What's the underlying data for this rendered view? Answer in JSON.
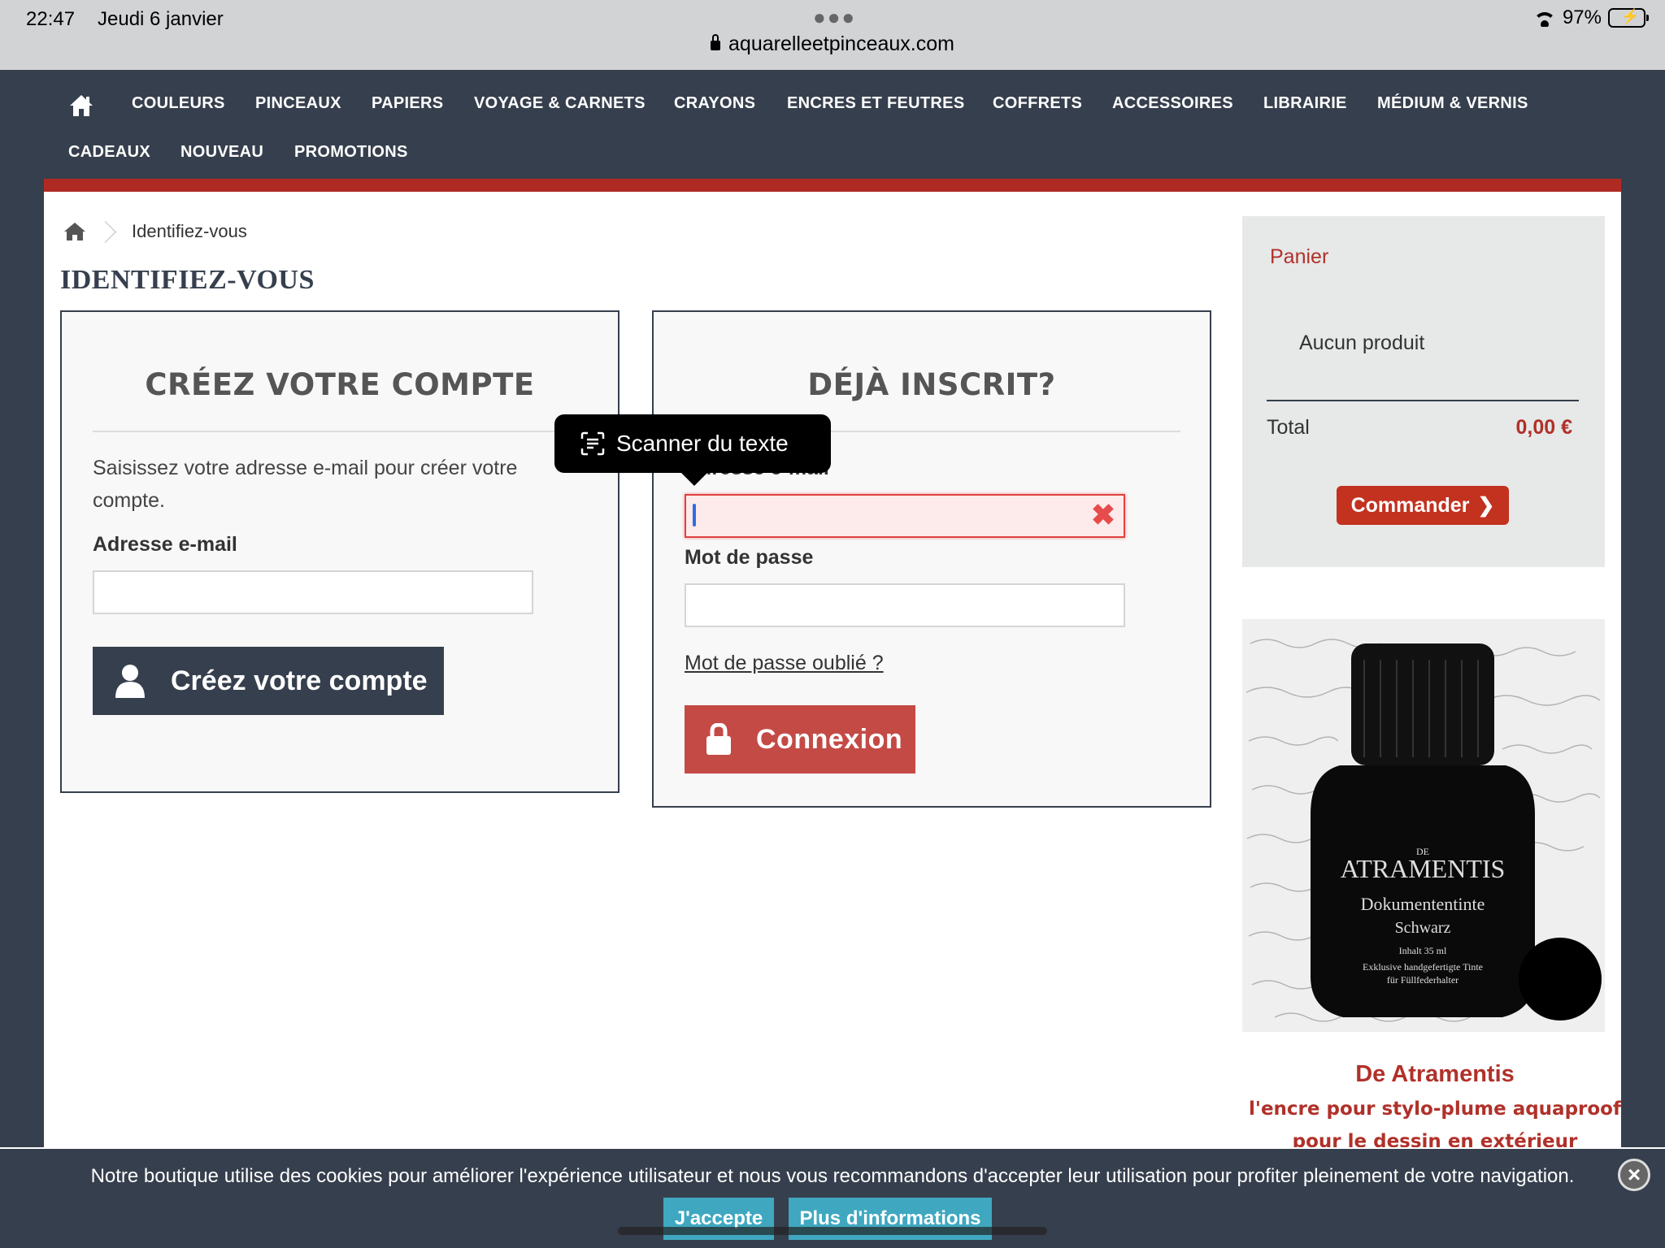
{
  "status_bar": {
    "time": "22:47",
    "date": "Jeudi 6 janvier",
    "battery": "97%",
    "url": "aquarelleetpinceaux.com"
  },
  "nav": {
    "row1": [
      "COULEURS",
      "PINCEAUX",
      "PAPIERS",
      "VOYAGE & CARNETS",
      "CRAYONS",
      "ENCRES ET FEUTRES",
      "COFFRETS",
      "ACCESSOIRES",
      "LIBRAIRIE",
      "MÉDIUM & VERNIS"
    ],
    "row2": [
      "CADEAUX",
      "NOUVEAU",
      "PROMOTIONS"
    ]
  },
  "breadcrumb": {
    "current": "Identifiez-vous"
  },
  "page_title": "IDENTIFIEZ-VOUS",
  "create_account": {
    "title": "CRÉEZ VOTRE COMPTE",
    "description": "Saisissez votre adresse e-mail pour créer votre compte.",
    "email_label": "Adresse e-mail",
    "email_value": "",
    "button": "Créez votre compte"
  },
  "login": {
    "title": "DÉJÀ INSCRIT?",
    "email_label": "Adresse e-mail",
    "email_value": "",
    "password_label": "Mot de passe",
    "password_value": "",
    "forgot": "Mot de passe oublié ?",
    "button": "Connexion"
  },
  "tooltip": {
    "label": "Scanner du texte"
  },
  "cart": {
    "title": "Panier",
    "empty": "Aucun produit",
    "total_label": "Total",
    "total_value": "0,00 €",
    "button": "Commander"
  },
  "ad": {
    "brand_top": "DE",
    "brand": "ATRAMENTIS",
    "product": "Dokumententinte",
    "color": "Schwarz",
    "volume": "Inhalt 35 ml",
    "tagline1": "Exklusive handgefertigte Tinte",
    "tagline2": "für Füllfederhalter",
    "caption_title": "De Atramentis",
    "caption_line1": "l'encre pour stylo-plume aquaproof",
    "caption_line2": "pour le dessin en extérieur"
  },
  "cookie": {
    "text": "Notre boutique utilise des cookies pour améliorer l'expérience utilisateur et nous vous recommandons d'accepter leur utilisation pour profiter pleinement de votre navigation.",
    "accept": "J'accepte",
    "more": "Plus d'informations"
  },
  "colors": {
    "nav_bg": "#363f4d",
    "accent_red": "#b0312a",
    "button_red": "#c44a45",
    "cookie_btn": "#3fa8c0"
  }
}
